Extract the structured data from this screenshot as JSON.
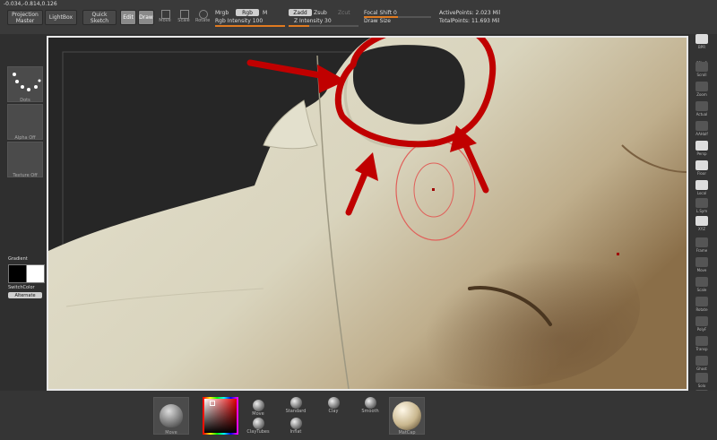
{
  "coords": "-0.034,-0.814,0.126",
  "toolbar": {
    "projection_master": "Projection Master",
    "lightbox": "LightBox",
    "quick_sketch": "Quick Sketch",
    "edit": "Edit",
    "draw": "Draw",
    "move": "Move",
    "scale": "Scale",
    "rotate": "Rotate",
    "mrgb": "Mrgb",
    "rgb": "Rgb",
    "m": "M",
    "rgb_intensity": "Rgb Intensity 100",
    "zadd": "Zadd",
    "zsub": "Zsub",
    "zcut": "Zcut",
    "z_intensity": "Z Intensity 30",
    "focal_shift": "Focal Shift 0",
    "draw_size": "Draw Size",
    "active_points": "ActivePoints: 2.023 Mil",
    "total_points": "TotalPoints: 11.693 Mil"
  },
  "left_panel": {
    "stroke_label": "Dots",
    "alpha_label": "Alpha Off",
    "texture_label": "Texture Off",
    "gradient": "Gradient",
    "switch_color": "SwitchColor",
    "alternate": "Alternate"
  },
  "right_panel": [
    "BPR",
    "SPix 3",
    "Scroll",
    "Zoom",
    "Actual",
    "AAHalf",
    "Persp",
    "Floor",
    "Local",
    "L.Sym",
    "XYZ",
    "Frame",
    "Move",
    "Scale",
    "Rotate",
    "PolyF",
    "Transp",
    "Ghost",
    "Solo",
    "Xpose"
  ],
  "bottom_bar": {
    "material_label": "Move",
    "brushes": [
      "Move",
      "Standard",
      "Clay",
      "Smooth",
      "ClayTubes",
      "Inflat"
    ],
    "matcap_label": "MatCap"
  },
  "canvas": {
    "model": "3D sculpt head mesh",
    "colors": {
      "skin": "#ddd8c4",
      "annotation": "#c00000",
      "brush_ring": "#e0605a"
    }
  }
}
